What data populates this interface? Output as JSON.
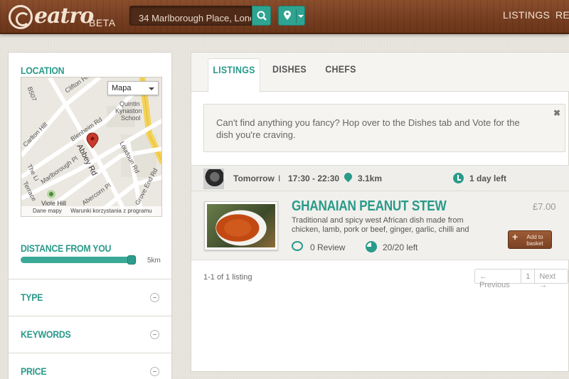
{
  "header": {
    "logo_text": "eatro",
    "beta_label": "BETA",
    "search_value": "34 Marlborough Place, Lond",
    "nav": [
      "LISTINGS",
      "REG"
    ],
    "accent_color": "#2fa391",
    "wood_color": "#7a4124"
  },
  "sidebar": {
    "location_title": "LOCATION",
    "map": {
      "type_select": "Mapa",
      "footer_left": "Dane mapy",
      "footer_right": "Warunki korzystania z programu",
      "labels": [
        "B507",
        "Clifton Hill",
        "Carlton Hill",
        "Quintin Kynaston School",
        "Blenheim Rd",
        "Abbey Rd",
        "Marlborough Pl",
        "Loudoun Rd",
        "Grove End Rd",
        "Abercorn Pl",
        "Terrace",
        "The Li",
        "Viole Hill"
      ]
    },
    "distance_title": "DISTANCE FROM YOU",
    "distance_max": "5km",
    "distance_fraction": 0.96,
    "sections": [
      "TYPE",
      "KEYWORDS",
      "PRICE"
    ]
  },
  "main": {
    "tabs": [
      "LISTINGS",
      "DISHES",
      "CHEFS"
    ],
    "notice": "Can't find anything you fancy? Hop over to the Dishes tab and Vote for the dish you're craving.",
    "notice_close": "✖",
    "meta": {
      "day": "Tomorrow",
      "sep": "I",
      "time": "17:30 - 22:30",
      "distance": "3.1km",
      "left": "1 day left"
    },
    "listing": {
      "title": "GHANAIAN PEANUT STEW",
      "description": "Traditional and spicy west African dish made from chicken, lamb, pork or beef, ginger, garlic, chilli and",
      "price": "£7.00",
      "reviews": "0 Review",
      "portions": "20/20 left",
      "add_button": "Add to basket"
    },
    "result_count": "1-1 of 1 listing",
    "pager": {
      "prev": "← Previous",
      "page": "1",
      "next": "Next →"
    }
  }
}
